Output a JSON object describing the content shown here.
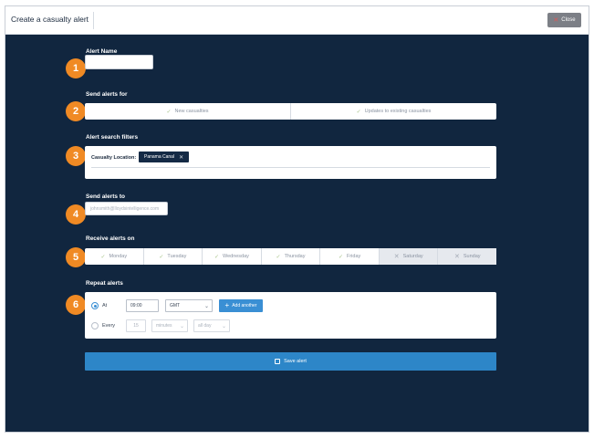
{
  "header": {
    "title": "Create a casualty alert",
    "close_label": "Close"
  },
  "steps": [
    "1",
    "2",
    "3",
    "4",
    "5",
    "6"
  ],
  "sections": {
    "alert_name": "Alert Name",
    "send_alerts_for": "Send alerts for",
    "search_filters": "Alert search filters",
    "send_alerts_to": "Send alerts to",
    "receive_alerts_on": "Receive alerts on",
    "repeat_alerts": "Repeat alerts"
  },
  "alert_name": {
    "value": ""
  },
  "send_for": {
    "options": [
      {
        "label": "New casualties",
        "checked": true
      },
      {
        "label": "Updates to existing casualties",
        "checked": true
      }
    ]
  },
  "filters": {
    "label": "Casualty Location:",
    "chip": "Panama Canal"
  },
  "send_to": {
    "value": "johnsmith@lloydsintelligence.com"
  },
  "days": [
    {
      "label": "Monday",
      "on": true
    },
    {
      "label": "Tuesday",
      "on": true
    },
    {
      "label": "Wednesday",
      "on": true
    },
    {
      "label": "Thursday",
      "on": true
    },
    {
      "label": "Friday",
      "on": true
    },
    {
      "label": "Saturday",
      "on": false
    },
    {
      "label": "Sunday",
      "on": false
    }
  ],
  "repeat": {
    "at_label": "At",
    "at_time": "09:00",
    "timezone": "GMT",
    "add_another": "Add another",
    "every_label": "Every",
    "every_value": "15",
    "unit": "minutes",
    "scope": "all day"
  },
  "save_label": "Save alert",
  "colors": {
    "background": "#11263f",
    "accent": "#f08a24",
    "primary": "#2d86c8"
  }
}
